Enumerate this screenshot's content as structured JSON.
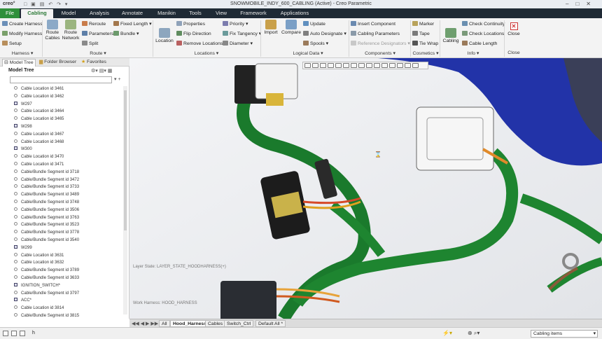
{
  "app": {
    "logo": "creo°",
    "title": "SNOWMOBILE_INDY_600_CABLING (Active) - Creo Parametric",
    "qat": "□ ▣ ▤ ↶ ↷ ▾"
  },
  "tabs": [
    "File",
    "Cabling",
    "Model",
    "Analysis",
    "Annotate",
    "Manikin",
    "Tools",
    "View",
    "Framework",
    "Applications"
  ],
  "ribbon": {
    "harness": {
      "items": [
        "Create Harness",
        "Modify Harness",
        "Setup"
      ],
      "group": "Harness ▾"
    },
    "route": {
      "route_cables": [
        "Route",
        "Cables"
      ],
      "route_network": [
        "Route",
        "Network"
      ],
      "items": [
        "Reroute",
        "Parameters",
        "Split"
      ],
      "fixed_length": "Fixed Length ▾",
      "bundle": "Bundle ▾",
      "group": "Route ▾"
    },
    "locations": {
      "location": "Location",
      "items": [
        "Properties",
        "Flip Direction",
        "Remove Locations"
      ],
      "priority": "Priority ▾",
      "fix_tangency": "Fix Tangency ▾",
      "diameter": "Diameter ▾",
      "group": "Locations ▾"
    },
    "logical": {
      "import": "Import",
      "compare": "Compare",
      "items": [
        "Update",
        "Auto Designate ▾",
        "Spools ▾"
      ],
      "group": "Logical Data ▾"
    },
    "components": {
      "items": [
        "Insert Component",
        "Cabling Parameters",
        "Reference Designators ▾"
      ],
      "group": "Components ▾"
    },
    "cosmetics": {
      "items": [
        "Marker",
        "Tape",
        "Tie Wrap"
      ],
      "group": "Cosmetics ▾"
    },
    "info": {
      "cabling": "Cabling",
      "items": [
        "Check Continuity",
        "Check Locations",
        "Cable Length"
      ],
      "group": "Info ▾"
    },
    "close": {
      "label": "Close",
      "group": "Close"
    }
  },
  "nav_tabs": [
    "Model Tree",
    "Folder Browser",
    "Favorites"
  ],
  "tree": {
    "header": "Model Tree",
    "rows": [
      "Cable Location id 3461",
      "Cable Location id 3462",
      "W297",
      "Cable Location id 3464",
      "Cable Location id 3465",
      "W298",
      "Cable Location id 3467",
      "Cable Location id 3468",
      "W300",
      "Cable Location id 3470",
      "Cable Location id 3471",
      "Cable/Bundle Segment id 3718",
      "Cable/Bundle Segment id 3472",
      "Cable/Bundle Segment id 3733",
      "Cable/Bundle Segment id 3489",
      "Cable/Bundle Segment id 3748",
      "Cable/Bundle Segment id 3506",
      "Cable/Bundle Segment id 3763",
      "Cable/Bundle Segment id 3523",
      "Cable/Bundle Segment id 3778",
      "Cable/Bundle Segment id 3540",
      "W299",
      "Cable Location id 3631",
      "Cable Location id 3632",
      "Cable/Bundle Segment id 3789",
      "Cable/Bundle Segment id 3633",
      "IGNITION_SWITCH*",
      "Cable/Bundle Segment id 3797",
      "ACC*",
      "Cable Location id 3814",
      "Cable/Bundle Segment id 3815"
    ]
  },
  "viewport": {
    "layer_state": "Layer State: LAYER_STATE_HOODHARNESS(+)",
    "work_harness": "Work Harness: HOOD_HARNESS"
  },
  "bottom_tabs": [
    "All",
    "Hood_Harness",
    "Cables",
    "Switch_Ctrl",
    "Default All *"
  ],
  "status": {
    "filter": "Cabling items",
    "cmd": "h"
  }
}
